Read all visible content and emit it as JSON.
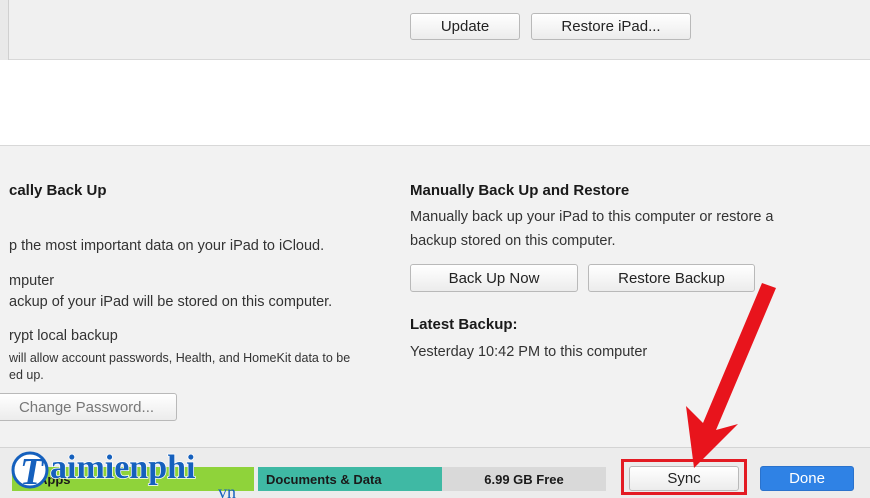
{
  "top": {
    "update_label": "Update",
    "restore_ipad_label": "Restore iPad..."
  },
  "left_column": {
    "heading": "cally Back Up",
    "icloud_desc": "p the most important data on your iPad to iCloud.",
    "computer_label": "mputer",
    "computer_desc": "ackup of your iPad will be stored on this computer.",
    "encrypt_label": "rypt local backup",
    "encrypt_desc_1": "will allow account passwords, Health, and HomeKit data to be",
    "encrypt_desc_2": "ed up.",
    "change_password_label": "Change Password..."
  },
  "right_column": {
    "heading": "Manually Back Up and Restore",
    "desc_1": "Manually back up your iPad to this computer or restore a",
    "desc_2": "backup stored on this computer.",
    "backup_now_label": "Back Up Now",
    "restore_backup_label": "Restore Backup",
    "latest_heading": "Latest Backup:",
    "latest_value": "Yesterday 10:42 PM to this computer"
  },
  "storage_bar": {
    "apps_label": "Apps",
    "documents_label": "Documents & Data",
    "free_label": "6.99 GB Free"
  },
  "footer": {
    "sync_label": "Sync",
    "done_label": "Done"
  },
  "watermark": {
    "brand_text": "aimienphi",
    "brand_suffix": "vn"
  },
  "colors": {
    "apps_segment": "#8fd33a",
    "documents_segment": "#3fb9a4",
    "free_segment": "#d9d9d9",
    "accent": "#2f82e5",
    "highlight": "#e31b23"
  }
}
